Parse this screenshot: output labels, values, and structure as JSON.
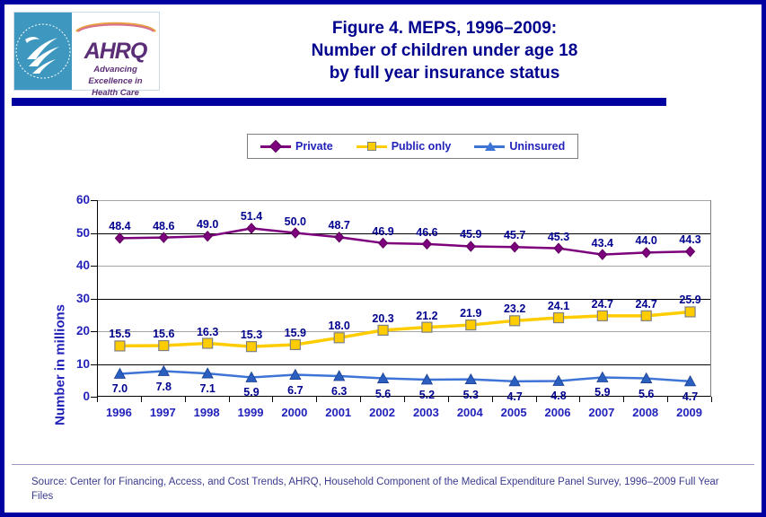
{
  "header": {
    "title_lines": [
      "Figure 4. MEPS, 1996–2009:",
      "Number of children under age 18",
      "by full year insurance status"
    ],
    "logo": {
      "seal_name": "hhs-seal",
      "acronym": "AHRQ",
      "tagline_lines": [
        "Advancing",
        "Excellence in",
        "Health Care"
      ]
    }
  },
  "footer": {
    "source": "Source: Center for Financing, Access, and Cost Trends, AHRQ, Household Component of the Medical Expenditure Panel Survey, 1996–2009 Full Year Files"
  },
  "colors": {
    "border": "#0000a0",
    "title": "#00008f",
    "label": "#2222bb",
    "private": "#7d007d",
    "public": "#ffcc00",
    "uninsured": "#3d74d6",
    "grid_gray": "#a6a6a6",
    "grid_black": "#000000"
  },
  "chart_data": {
    "type": "line",
    "title": "Figure 4. MEPS, 1996–2009: Number of children under age 18 by full year insurance status",
    "xlabel": "",
    "ylabel": "Number in millions",
    "ylim": [
      0,
      60
    ],
    "ytick_values": [
      0,
      10,
      20,
      30,
      40,
      50,
      60
    ],
    "grid": true,
    "legend_position": "top",
    "categories": [
      "1996",
      "1997",
      "1998",
      "1999",
      "2000",
      "2001",
      "2002",
      "2003",
      "2004",
      "2005",
      "2006",
      "2007",
      "2008",
      "2009"
    ],
    "series": [
      {
        "name": "Private",
        "marker": "diamond",
        "color": "#7d007d",
        "values": [
          48.4,
          48.6,
          49.0,
          51.4,
          50.0,
          48.7,
          46.9,
          46.6,
          45.9,
          45.7,
          45.3,
          43.4,
          44.0,
          44.3
        ],
        "labels": [
          "48.4",
          "48.6",
          "49.0",
          "51.4",
          "50.0",
          "48.7",
          "46.9",
          "46.6",
          "45.9",
          "45.7",
          "45.3",
          "43.4",
          "44.0",
          "44.3"
        ]
      },
      {
        "name": "Public only",
        "marker": "square",
        "color": "#ffcc00",
        "values": [
          15.5,
          15.6,
          16.3,
          15.3,
          15.9,
          18.0,
          20.3,
          21.2,
          21.9,
          23.2,
          24.1,
          24.7,
          24.7,
          25.9
        ],
        "labels": [
          "15.5",
          "15.6",
          "16.3",
          "15.3",
          "15.9",
          "18.0",
          "20.3",
          "21.2",
          "21.9",
          "23.2",
          "24.1",
          "24.7",
          "24.7",
          "25.9"
        ]
      },
      {
        "name": "Uninsured",
        "marker": "triangle",
        "color": "#3d74d6",
        "values": [
          7.0,
          7.8,
          7.1,
          5.9,
          6.7,
          6.3,
          5.6,
          5.2,
          5.3,
          4.7,
          4.8,
          5.9,
          5.6,
          4.7
        ],
        "labels": [
          "7.0",
          "7.8",
          "7.1",
          "5.9",
          "6.7",
          "6.3",
          "5.6",
          "5.2",
          "5.3",
          "4.7",
          "4.8",
          "5.9",
          "5.6",
          "4.7"
        ]
      }
    ]
  }
}
